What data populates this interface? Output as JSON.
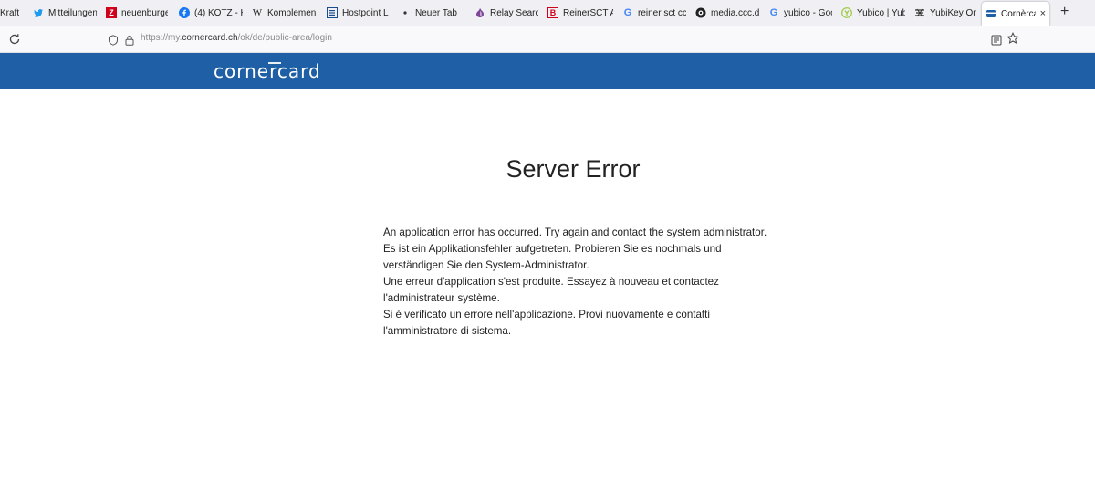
{
  "tabs": [
    {
      "label": "Kraft",
      "icon": "page-icon"
    },
    {
      "label": "Mitteilungen",
      "icon": "twitter-bird-icon",
      "color": "#1d9bf0"
    },
    {
      "label": "neuenburger",
      "icon": "z-logo-icon",
      "color": "#d0021b"
    },
    {
      "label": "(4) KOTZ - Ko",
      "icon": "facebook-icon",
      "color": "#1877f2"
    },
    {
      "label": "Komplement",
      "icon": "wikipedia-w-icon"
    },
    {
      "label": "Hostpoint Lo",
      "icon": "hostpoint-icon",
      "color": "#1a4d8f"
    },
    {
      "label": "Neuer Tab",
      "icon": "dot-icon"
    },
    {
      "label": "Relay Search",
      "icon": "onion-icon",
      "color": "#7d4698"
    },
    {
      "label": "ReinerSCT Au",
      "icon": "b-logo-icon",
      "color": "#d0021b"
    },
    {
      "label": "reiner sct ccc",
      "icon": "google-g-icon"
    },
    {
      "label": "media.ccc.de",
      "icon": "ccc-icon"
    },
    {
      "label": "yubico - Goo",
      "icon": "google-g-icon"
    },
    {
      "label": "Yubico | Yubi",
      "icon": "yubico-icon",
      "color": "#9aca3c"
    },
    {
      "label": "YubiKey Onlin",
      "icon": "yubikey-icon"
    },
    {
      "label": "Cornèrcard",
      "icon": "cornercard-icon",
      "active": true
    }
  ],
  "new_tab_symbol": "+",
  "close_symbol": "×",
  "navbar": {
    "url_prefix": "https://my.",
    "url_domain": "cornercard.ch",
    "url_path": "/ok/de/public-area/login"
  },
  "site": {
    "logo_text": "cornercard",
    "header_color": "#1f5fa5"
  },
  "page": {
    "title": "Server Error",
    "messages": [
      "An application error has occurred. Try again and contact the system administrator.",
      "Es ist ein Applikationsfehler aufgetreten. Probieren Sie es nochmals und verständigen Sie den System-Administrator.",
      "Une erreur d'application s'est produite. Essayez à nouveau et contactez l'administrateur système.",
      "Si è verificato un errore nell'applicazione. Provi nuovamente e contatti l'amministratore di sistema."
    ]
  }
}
